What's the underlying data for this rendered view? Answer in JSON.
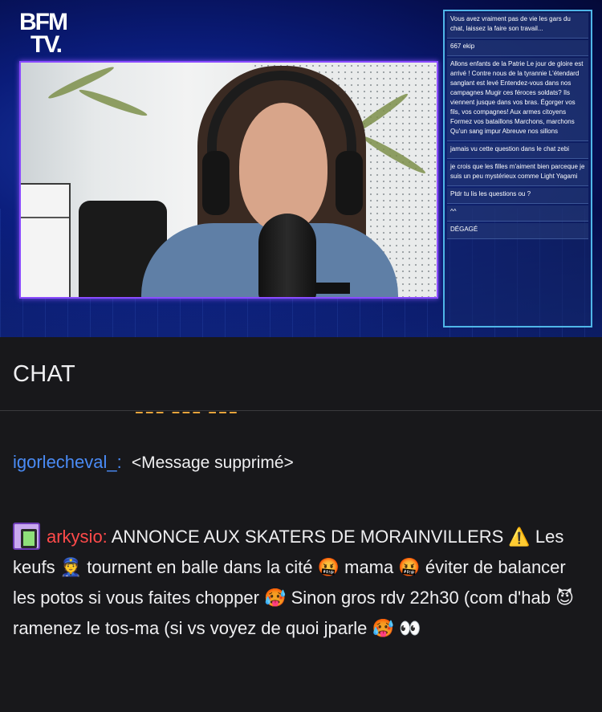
{
  "stream": {
    "channel_logo_line1": "BFM",
    "channel_logo_line2": "TV.",
    "overlay_chat": [
      {
        "user": "",
        "text": "Vous avez vraiment pas de vie les gars du chat, laissez la faire son travail..."
      },
      {
        "user": "",
        "text": "667 ekip"
      },
      {
        "user": "",
        "text": "Allons enfants de la Patrie Le jour de gloire est arrivé ! Contre nous de la tyrannie L'étendard sanglant est levé Entendez-vous dans nos campagnes Mugir ces féroces soldats? Ils viennent jusque dans vos bras. Égorger vos fils, vos compagnes! Aux armes citoyens Formez vos bataillons Marchons, marchons Qu'un sang impur Abreuve nos sillons"
      },
      {
        "user": "",
        "text": "jamais vu cette question dans le chat zebi"
      },
      {
        "user": "",
        "text": "je crois que les filles m'aiment bien parceque je suis un peu mystérieux comme Light Yagami"
      },
      {
        "user": "",
        "text": "Ptdr tu lis les questions ou ?"
      },
      {
        "user": "",
        "text": "^^"
      },
      {
        "user": "",
        "text": "DÉGAGÉ"
      }
    ]
  },
  "chat": {
    "title": "CHAT",
    "messages": [
      {
        "username": "igorlecheval_:",
        "text": "<Message supprimé>",
        "user_color": "#4a8bf5"
      },
      {
        "username": "arkysio:",
        "user_color": "#ff4a4a",
        "text": "ANNONCE AUX SKATERS DE MORAINVILLERS ⚠️ Les keufs 👮 tournent en balle dans la cité 🤬 mama 🤬 éviter de balancer les potos si vous faites chopper 🥵 Sinon gros rdv 22h30 (com d'hab 😈 ramenez le tos-ma (si vs voyez de quoi jparle 🥵 👀"
      }
    ]
  }
}
